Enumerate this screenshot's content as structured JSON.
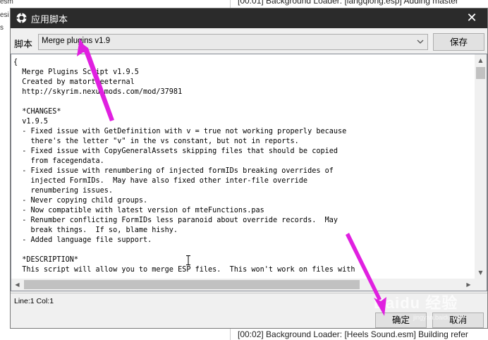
{
  "background": {
    "left_fragments": [
      "esm",
      "esi",
      "s"
    ],
    "log_top": "[00:01] Background Loader: [langqiong.esp] Adding master",
    "log_bottom": "[00:02] Background Loader: [Heels Sound.esm] Building refer"
  },
  "dialog": {
    "title": "应用脚本",
    "close_glyph": "✕",
    "script_label": "脚本",
    "selected_script": "Merge plugins v1.9",
    "save_label": "保存",
    "status": "Line:1 Col:1",
    "ok_label": "确定",
    "cancel_label": "取消"
  },
  "editor": {
    "content": "{\n  Merge Plugins Script v1.9.5\n  Created by matortheeternal\n  http://skyrim.nexusmods.com/mod/37981\n\n  *CHANGES*\n  v1.9.5\n  - Fixed issue with GetDefinition with v = true not working properly because\n    there's the letter \"v\" in the vs constant, but not in reports.\n  - Fixed issue with CopyGeneralAssets skipping files that should be copied\n    from facegendata.\n  - Fixed issue with renumbering of injected formIDs breaking overrides of\n    injected FormIDs.  May have also fixed other inter-file override\n    renumbering issues.\n  - Never copying child groups.\n  - Now compatible with latest version of mteFunctions.pas\n  - Renumber conflicting FormIDs less paranoid about override records.  May\n    break things.  If so, blame hishy.\n  - Added language file support.\n\n  *DESCRIPTION*\n  This script will allow you to merge ESP files.  This won't work on files with"
  },
  "watermark": {
    "brand": "Baidu 经验",
    "url": "jingyan.baidu.com"
  },
  "annotation_color": "#e020e0",
  "icons": {
    "app": "app-gear-icon",
    "dropdown": "chevron-down-icon"
  }
}
